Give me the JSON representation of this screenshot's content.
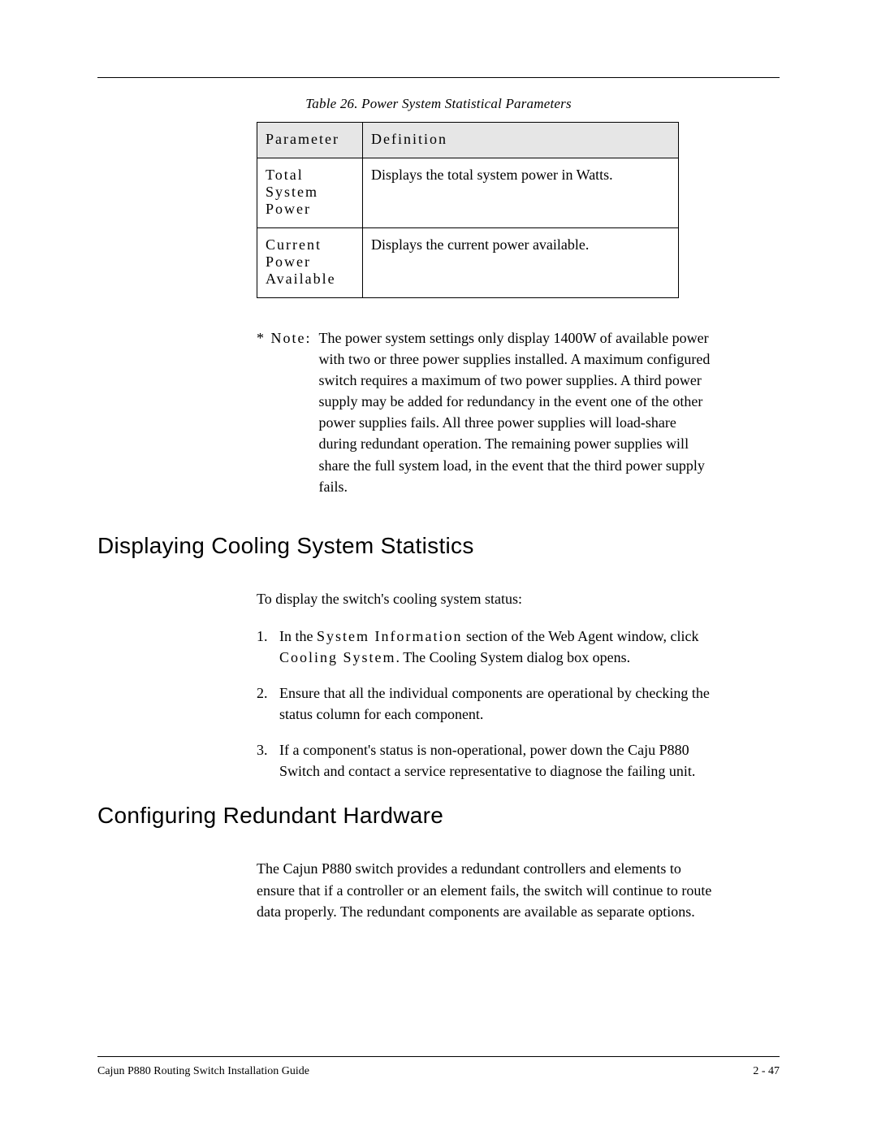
{
  "table": {
    "caption": "Table 26.  Power System Statistical Parameters",
    "headers": {
      "param": "Parameter",
      "def": "Definition"
    },
    "rows": [
      {
        "param": "Total System Power",
        "def": "Displays the total system power in Watts."
      },
      {
        "param": "Current Power Available",
        "def": "Displays the current power available."
      }
    ]
  },
  "note": {
    "label": "* Note:",
    "text": "The power system settings only display 1400W of available power with two or three power supplies installed. A maximum configured switch requires a maximum of two power supplies. A third power supply may be added for redundancy in the event one of the other power supplies fails. All three power supplies will load-share during redundant operation. The remaining power supplies will share the full system load, in the event that the third power supply fails."
  },
  "section1": {
    "heading": "Displaying Cooling System Statistics",
    "intro": "To display the switch's cooling system status:",
    "steps": [
      {
        "num": "1.",
        "pre": "In the ",
        "bold1": "System Information",
        "mid": " section of the Web Agent window, click ",
        "bold2": "Cooling System",
        "post": ". The Cooling System dialog box opens."
      },
      {
        "num": "2.",
        "text": "Ensure that all the individual components are operational by checking the status column for each component."
      },
      {
        "num": "3.",
        "text": "If a component's status is non-operational, power down the Caju P880 Switch and contact a service representative to diagnose the failing unit."
      }
    ]
  },
  "section2": {
    "heading": "Configuring Redundant Hardware",
    "para": "The Cajun P880 switch provides a redundant controllers and elements to ensure that if a controller or an element fails, the switch will continue to route data properly. The redundant components are available as separate options."
  },
  "footer": {
    "left": "Cajun P880 Routing Switch Installation Guide",
    "right": "2 - 47"
  }
}
